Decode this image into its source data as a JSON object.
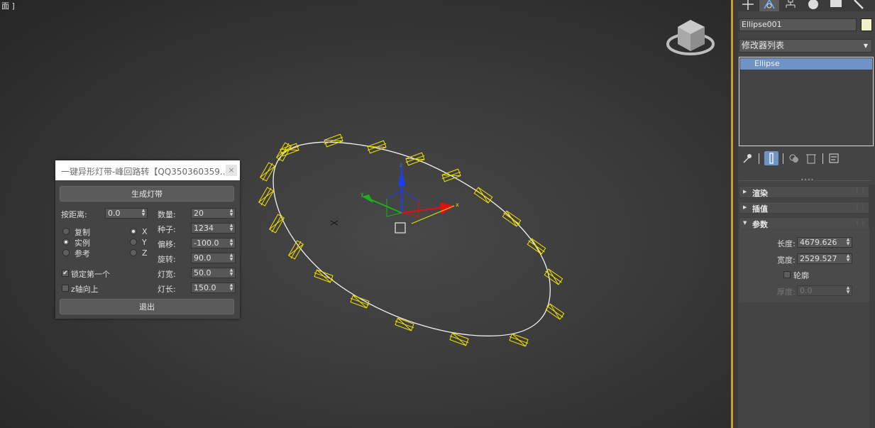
{
  "viewport": {
    "label": "面 ]",
    "axis_labels": {
      "x": "x",
      "y": "y",
      "z": "z"
    }
  },
  "dialog": {
    "title": "一键异形灯带-峰回路转【QQ350360359...",
    "close_label": "×",
    "generate_button": "生成灯带",
    "exit_button": "退出",
    "distance_label": "按距离:",
    "distance_value": "0.0",
    "copy_modes": [
      {
        "label": "复制",
        "selected": false
      },
      {
        "label": "实例",
        "selected": true
      },
      {
        "label": "参考",
        "selected": false
      }
    ],
    "axes": [
      {
        "label": "X",
        "selected": true
      },
      {
        "label": "Y",
        "selected": false
      },
      {
        "label": "Z",
        "selected": false
      }
    ],
    "lock_first_label": "锁定第一个",
    "lock_first_checked": true,
    "z_up_label": "z轴向上",
    "z_up_checked": false,
    "fields": [
      {
        "label": "数量:",
        "value": "20"
      },
      {
        "label": "种子:",
        "value": "1234"
      },
      {
        "label": "偏移:",
        "value": "-100.0"
      },
      {
        "label": "旋转:",
        "value": "90.0"
      },
      {
        "label": "灯宽:",
        "value": "50.0"
      },
      {
        "label": "灯长:",
        "value": "150.0"
      }
    ]
  },
  "panel": {
    "tabs": [
      "create-tab",
      "modify-tab",
      "hierarchy-tab",
      "motion-tab",
      "display-tab",
      "utilities-tab"
    ],
    "object_name": "Ellipse001",
    "object_color": "#f0f3c8",
    "modifier_list": "修改器列表",
    "stack_item": "Ellipse",
    "rollouts": {
      "render": "渲染",
      "interpolation": "插值",
      "parameters": "参数"
    },
    "params": {
      "length_label": "长度:",
      "length_value": "4679.626",
      "width_label": "宽度:",
      "width_value": "2529.527",
      "outline_label": "轮廓",
      "outline_checked": false,
      "thickness_label": "厚度:",
      "thickness_value": "0.0"
    }
  },
  "colors": {
    "accent": "#6f93c4",
    "viewport_border": "#c8a030",
    "light_gizmo": "#f0e000"
  }
}
